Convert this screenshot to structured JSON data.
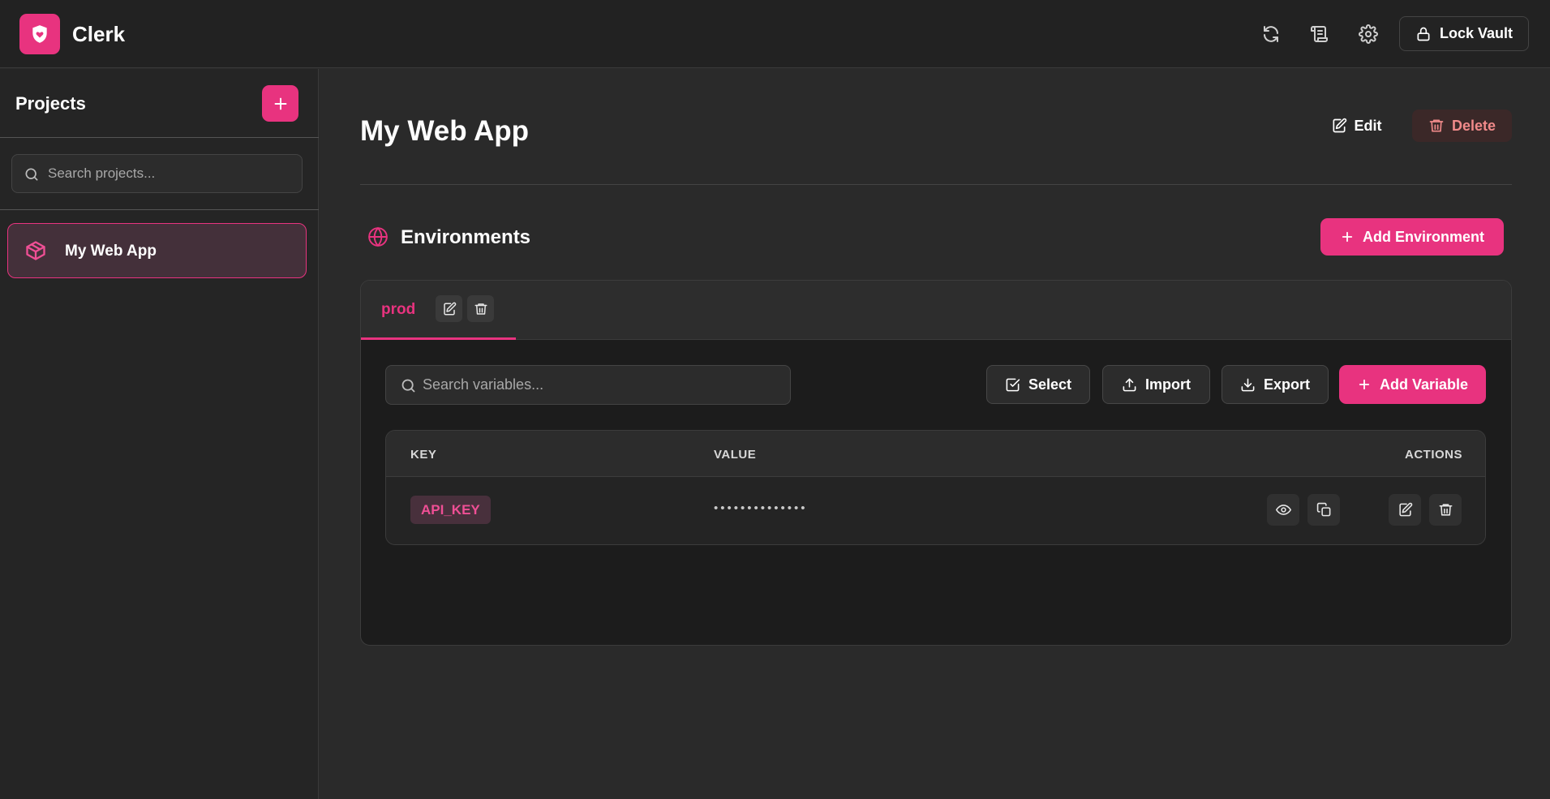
{
  "app": {
    "title": "Clerk",
    "accent_color": "#e8337f",
    "logo_icon": "shield-heart-icon"
  },
  "header": {
    "icons": [
      "refresh-icon",
      "audit-log-icon",
      "gear-icon"
    ],
    "lock_button_label": "Lock Vault"
  },
  "sidebar": {
    "title": "Projects",
    "add_icon": "plus-icon",
    "search_placeholder": "Search projects...",
    "projects": [
      {
        "label": "My Web App",
        "icon": "package-icon",
        "selected": true
      }
    ]
  },
  "main": {
    "title": "My Web App",
    "edit_label": "Edit",
    "delete_label": "Delete",
    "environments_title": "Environments",
    "add_environment_label": "Add Environment",
    "tabs": [
      {
        "label": "prod",
        "active": true
      }
    ],
    "variables": {
      "search_placeholder": "Search variables...",
      "select_label": "Select",
      "import_label": "Import",
      "export_label": "Export",
      "add_variable_label": "Add Variable",
      "columns": [
        "KEY",
        "VALUE",
        "ACTIONS"
      ],
      "rows": [
        {
          "key": "API_KEY",
          "value_masked": "••••••••••••••"
        }
      ]
    }
  }
}
